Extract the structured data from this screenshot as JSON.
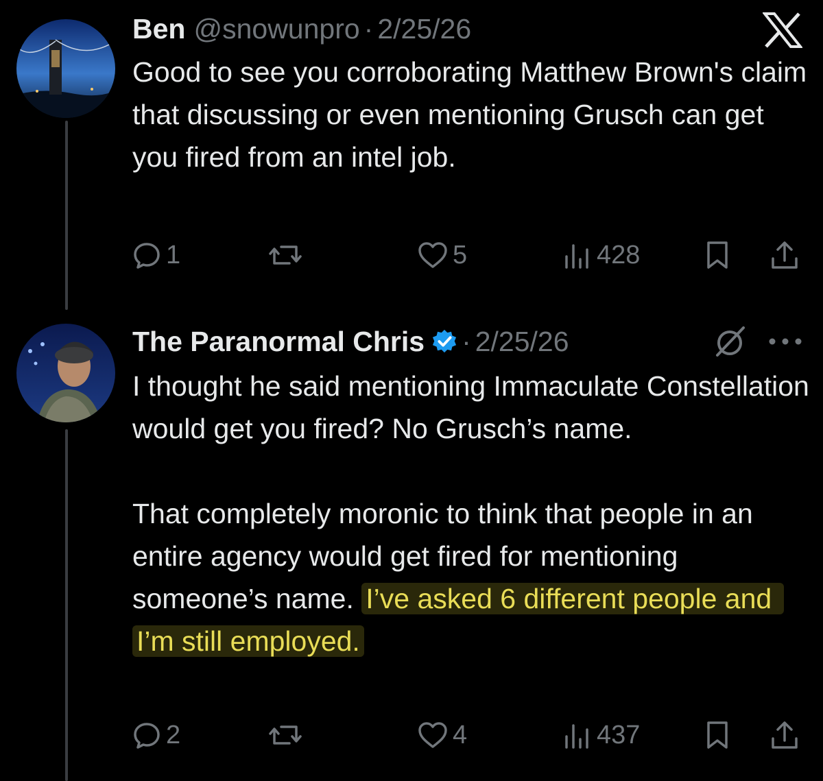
{
  "tweets": [
    {
      "name": "Ben",
      "handle": "@snowunpro",
      "separator": "·",
      "date": "2/25/26",
      "text": "Good to see you corroborating Matthew Brown's claim that discussing or even mentioning Grusch can get you fired from an intel job.",
      "highlight": "",
      "actions": {
        "replies": "1",
        "retweets": "",
        "likes": "5",
        "views": "428"
      },
      "icons": [
        "reply-icon",
        "retweet-icon",
        "like-icon",
        "views-icon",
        "bookmark-icon",
        "share-icon"
      ]
    },
    {
      "name": "The Paranormal Chris",
      "handle": "",
      "separator": "·",
      "date": "2/25/26",
      "verified": true,
      "text": "I thought he said mentioning Immaculate Constellation would get you fired? No Grusch’s name.\n\nThat completely moronic to think that people in an entire agency would get fired for mentioning someone’s name. ",
      "highlight": "I’ve asked 6 different people and I’m still employed.",
      "actions": {
        "replies": "2",
        "retweets": "",
        "likes": "4",
        "views": "437"
      },
      "icons": [
        "reply-icon",
        "retweet-icon",
        "like-icon",
        "views-icon",
        "bookmark-icon",
        "share-icon"
      ]
    }
  ],
  "colors": {
    "background": "#000000",
    "text": "#e7e9ea",
    "muted": "#71767b",
    "verified": "#1d9bf0",
    "highlight": "#e9dd57"
  },
  "header_icons": [
    "x-logo-icon",
    "grok-icon",
    "more-icon"
  ]
}
